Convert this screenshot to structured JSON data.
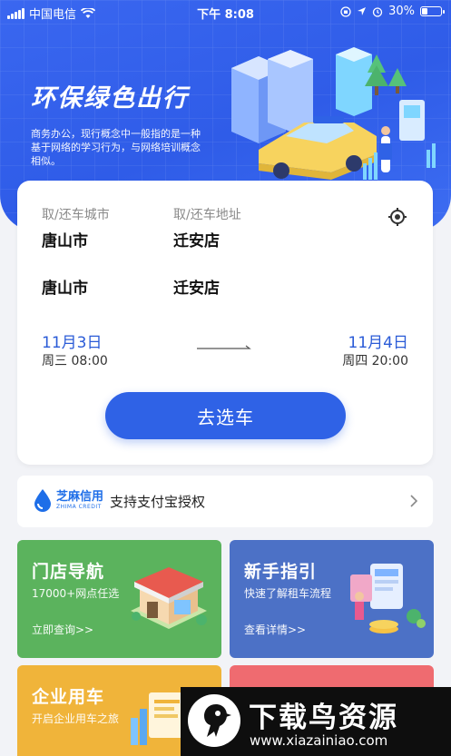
{
  "status_bar": {
    "carrier": "中国电信",
    "time": "下午 8:08",
    "battery": "30%"
  },
  "hero": {
    "title": "环保绿色出行",
    "description": "商务办公，现行概念中一般指的是一种基于网络的学习行为，与网络培训概念相似。"
  },
  "booking": {
    "pickup_city_label": "取/还车城市",
    "pickup_address_label": "取/还车地址",
    "pickup_city": "唐山市",
    "pickup_store": "迁安店",
    "return_city": "唐山市",
    "return_store": "迁安店",
    "start_date": "11月3日",
    "start_time": "周三 08:00",
    "end_date": "11月4日",
    "end_time": "周四 20:00",
    "submit_label": "去选车"
  },
  "zhima": {
    "logo_cn": "芝麻信用",
    "logo_en": "ZHIMA CREDIT",
    "text": "支持支付宝授权"
  },
  "tiles": [
    {
      "title": "门店导航",
      "subtitle": "17000+网点任选",
      "link": "立即查询>>",
      "color": "#5bb35d"
    },
    {
      "title": "新手指引",
      "subtitle": "快速了解租车流程",
      "link": "查看详情>>",
      "color": "#4c71c6"
    },
    {
      "title": "企业用车",
      "subtitle": "开启企业用车之旅",
      "color": "#f0b43a"
    },
    {
      "title": "",
      "subtitle": "",
      "color": "#ef6b70"
    }
  ],
  "watermark": {
    "title": "下载鸟资源",
    "url": "www.xiazainiao.com"
  },
  "colors": {
    "primary": "#2f62e6",
    "date_blue": "#2a5bd7"
  }
}
